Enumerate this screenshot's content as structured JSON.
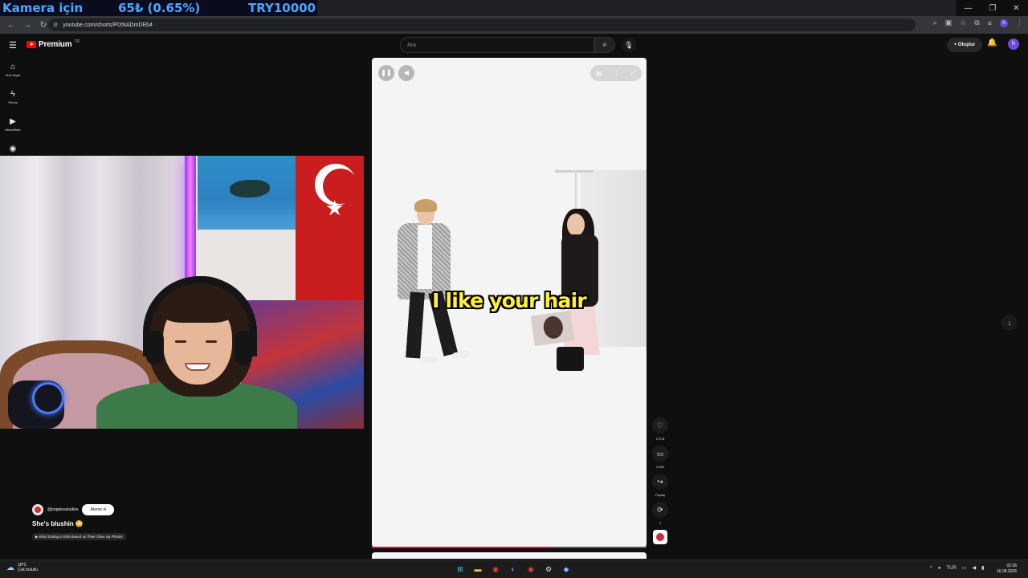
{
  "overlay": {
    "camera_label": "Kamera için",
    "donation_status": "65₺ (0.65%)",
    "goal": "TRY10000"
  },
  "browser": {
    "url": "youtube.com/shorts/PD5tADmDEb4",
    "profile_initial": "h"
  },
  "youtube": {
    "logo_text": "Premium",
    "logo_region": "TR",
    "search_placeholder": "Ara",
    "create_label": "Oluştur",
    "avatar_initial": "h",
    "nav": [
      {
        "label": "Ana Sayfa",
        "icon": "home-icon"
      },
      {
        "label": "Shorts",
        "icon": "shorts-icon"
      },
      {
        "label": "Abonelikler",
        "icon": "subscriptions-icon"
      },
      {
        "label": "",
        "icon": "you-icon"
      }
    ]
  },
  "short": {
    "caption": "I like your hair",
    "channel": "@popplesstudios",
    "subscribe_label": "Abone ol",
    "title": "She's blushin 😳",
    "related": "▶ Blind Dating 6 Girls Based on Their Glow Up Photos",
    "progress": 0.67,
    "actions": {
      "likes": "172 B",
      "comments": "3.392",
      "share": "Paylaş",
      "remix": "2"
    }
  },
  "taskbar": {
    "temperature": "18°C",
    "weather": "Çok bulutlu",
    "language": "TUR",
    "time": "02:36",
    "date": "16.08.2026"
  },
  "colors": {
    "overlay_text": "#4aa8ff",
    "caption": "#ffef3a",
    "youtube_red": "#ff0000",
    "progress": "#ff0033"
  }
}
